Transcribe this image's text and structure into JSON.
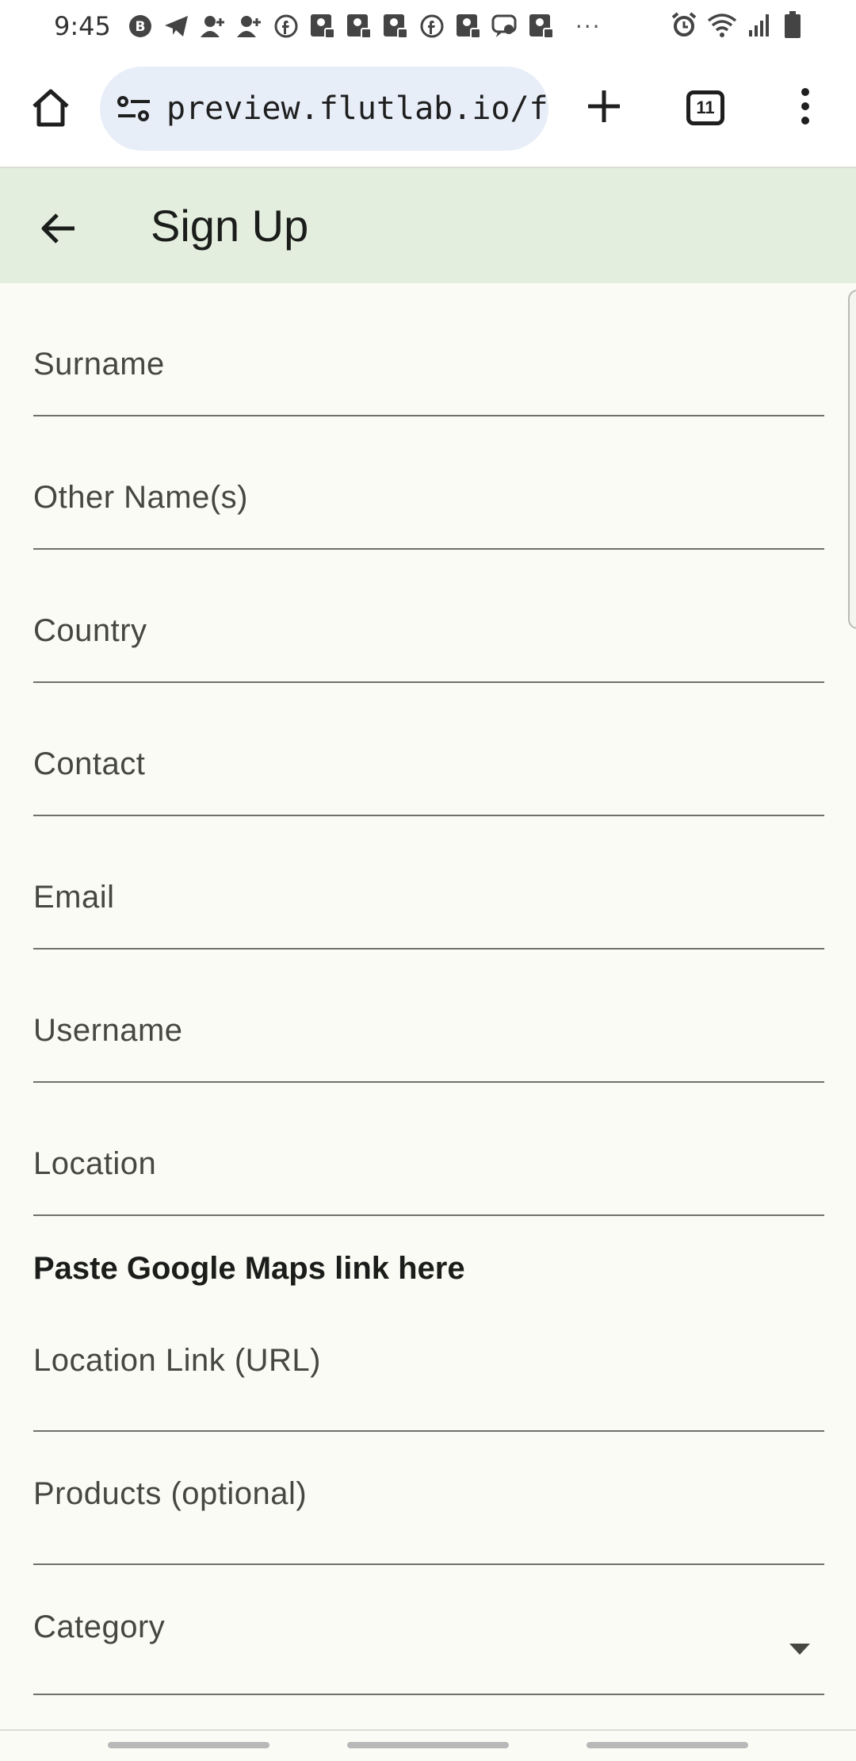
{
  "status_bar": {
    "time": "9:45",
    "left_icons": [
      "b-circle-icon",
      "telegram-icon",
      "person-add-icon",
      "person-add-icon",
      "facebook-icon",
      "image-badge-icon",
      "image-badge-icon",
      "image-badge-icon",
      "facebook-icon",
      "image-badge-icon",
      "chat-icon",
      "image-badge-icon"
    ],
    "overflow": "···",
    "right_icons": [
      "alarm-icon",
      "wifi-icon",
      "signal-icon",
      "battery-icon"
    ]
  },
  "browser": {
    "url": "preview.flutlab.io/feni_",
    "tab_count": "11"
  },
  "app_bar": {
    "title": "Sign Up"
  },
  "form": {
    "fields": [
      {
        "label": "Surname"
      },
      {
        "label": "Other Name(s)"
      },
      {
        "label": "Country"
      },
      {
        "label": "Contact"
      },
      {
        "label": "Email"
      },
      {
        "label": "Username"
      },
      {
        "label": "Location"
      }
    ],
    "note": "Paste Google Maps link here",
    "location_link": {
      "label": "Location Link (URL)"
    },
    "products": {
      "label": "Products (optional)"
    },
    "category": {
      "label": "Category"
    }
  },
  "colors": {
    "app_bar_bg": "#e3eedf",
    "page_bg": "#fafbf5",
    "url_pill_bg": "#e8eef8"
  }
}
